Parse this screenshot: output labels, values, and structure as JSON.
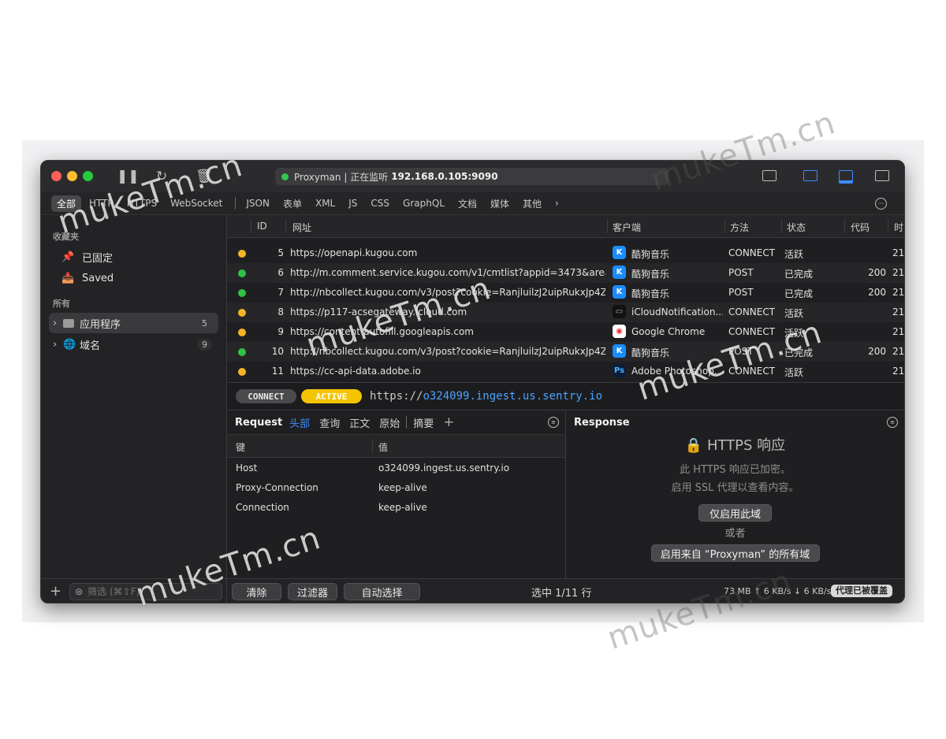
{
  "titlebar": {
    "app_status": "Proxyman | 正在监听",
    "address": "192.168.0.105:9090",
    "status_color": "#30c94a"
  },
  "filter_tabs": [
    "全部",
    "HTTP",
    "HTTPS",
    "WebSocket",
    "JSON",
    "表单",
    "XML",
    "JS",
    "CSS",
    "GraphQL",
    "文档",
    "媒体",
    "其他"
  ],
  "sidebar": {
    "favorites_header": "收藏夹",
    "pinned": "已固定",
    "saved": "Saved",
    "all_header": "所有",
    "apps_label": "应用程序",
    "apps_count": "5",
    "domains_label": "域名",
    "domains_count": "9",
    "filter_placeholder": "筛选 (⌘⇧F)"
  },
  "table": {
    "headers": {
      "id": "ID",
      "url": "网址",
      "client": "客户端",
      "method": "方法",
      "status": "状态",
      "code": "代码",
      "time": "时"
    },
    "rows": [
      {
        "id": "5",
        "url": "https://openapi.kugou.com",
        "client": "酷狗音乐",
        "method": "CONNECT",
        "status": "活跃",
        "code": "",
        "time": "21",
        "dot": "#f5b325",
        "icon": "kugou"
      },
      {
        "id": "6",
        "url": "http://m.comment.service.kugou.com/v1/cmtlist?appid=3473&area_co...",
        "client": "酷狗音乐",
        "method": "POST",
        "status": "已完成",
        "code": "200",
        "time": "21",
        "dot": "#2fc244",
        "icon": "kugou"
      },
      {
        "id": "7",
        "url": "http://nbcollect.kugou.com/v3/post?cookie=RanjluilzJ2uipRukxJp4Zka...",
        "client": "酷狗音乐",
        "method": "POST",
        "status": "已完成",
        "code": "200",
        "time": "21",
        "dot": "#2fc244",
        "icon": "kugou"
      },
      {
        "id": "8",
        "url": "https://p117-acsegateway.icloud.com",
        "client": "iCloudNotification...",
        "method": "CONNECT",
        "status": "活跃",
        "code": "",
        "time": "21",
        "dot": "#f5b325",
        "icon": "terminal"
      },
      {
        "id": "9",
        "url": "https://content-autofill.googleapis.com",
        "client": "Google Chrome",
        "method": "CONNECT",
        "status": "活跃",
        "code": "",
        "time": "21",
        "dot": "#f5b325",
        "icon": "chrome"
      },
      {
        "id": "10",
        "url": "http://nbcollect.kugou.com/v3/post?cookie=RanjluilzJ2uipRukxJp4Zka...",
        "client": "酷狗音乐",
        "method": "POST",
        "status": "已完成",
        "code": "200",
        "time": "21",
        "dot": "#2fc244",
        "icon": "kugou"
      },
      {
        "id": "11",
        "url": "https://cc-api-data.adobe.io",
        "client": "Adobe Photoshop...",
        "method": "CONNECT",
        "status": "活跃",
        "code": "",
        "time": "21",
        "dot": "#f5b325",
        "icon": "ps"
      }
    ]
  },
  "detail": {
    "method_pill": "CONNECT",
    "state_pill": "ACTIVE",
    "url_prefix": "https://",
    "url_host": "o324099.ingest.us.sentry.io"
  },
  "request": {
    "title": "Request",
    "tabs": [
      "头部",
      "查询",
      "正文",
      "原始",
      "摘要"
    ],
    "key_header": "键",
    "value_header": "值",
    "headers": [
      {
        "key": "Host",
        "value": "o324099.ingest.us.sentry.io"
      },
      {
        "key": "Proxy-Connection",
        "value": "keep-alive"
      },
      {
        "key": "Connection",
        "value": "keep-alive"
      }
    ]
  },
  "response": {
    "title": "Response",
    "encrypted_title": "HTTPS 响应",
    "line1": "此 HTTPS 响应已加密。",
    "line2": "启用 SSL 代理以查看内容。",
    "btn_this_domain": "仅启用此域",
    "or": "或者",
    "btn_all_domains": "启用来自 “Proxyman” 的所有域"
  },
  "statusbar": {
    "clear": "清除",
    "filter": "过滤器",
    "autoselect": "自动选择",
    "selection": "选中 1/11 行",
    "traffic": "73 MB ↑ 6 KB/s ↓ 6 KB/s",
    "proxy_badge": "代理已被覆盖"
  },
  "watermarks": [
    "mukeTm.cn"
  ]
}
